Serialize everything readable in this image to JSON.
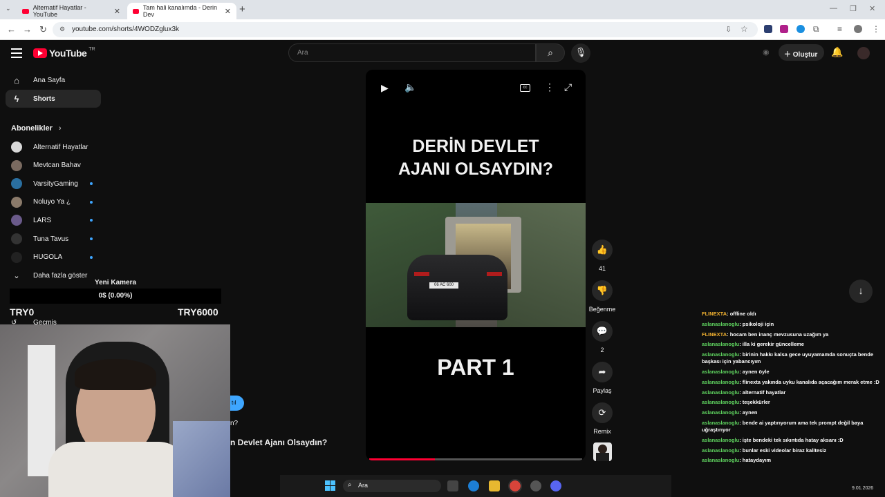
{
  "browser": {
    "tabs": [
      {
        "title": "Alternatif Hayatlar - YouTube"
      },
      {
        "title": "Tam hali kanalımda - Derin Dev"
      }
    ],
    "url": "youtube.com/shorts/4WODZglux3k"
  },
  "header": {
    "logo": "YouTube",
    "country": "TR",
    "search_placeholder": "Ara",
    "create_label": "Oluştur"
  },
  "sidebar": {
    "items": [
      {
        "label": "Ana Sayfa",
        "icon": "home-icon"
      },
      {
        "label": "Shorts",
        "icon": "shorts-icon"
      }
    ],
    "subs_heading": "Abonelikler",
    "subscriptions": [
      {
        "name": "Alternatif Hayatlar",
        "color": "#d8d8d8",
        "live": false
      },
      {
        "name": "Mevtcan Bahav",
        "color": "#7a6a60",
        "live": false
      },
      {
        "name": "VarsityGaming",
        "color": "#2a6fa0",
        "live": true
      },
      {
        "name": "Noluyo Ya ¿",
        "color": "#8a7a6a",
        "live": true
      },
      {
        "name": "LARS",
        "color": "#6a5a8a",
        "live": true
      },
      {
        "name": "Tuna Tavus",
        "color": "#333333",
        "live": true
      },
      {
        "name": "HUGOLA",
        "color": "#222222",
        "live": true
      }
    ],
    "more_label": "Daha fazla göster",
    "history_label": "Geçmiş"
  },
  "overlay": {
    "camera_title": "Yeni Kamera",
    "camera_progress": "0$ (0.00%)",
    "try_left": "TRY0",
    "try_right": "TRY6000"
  },
  "short": {
    "title_line1": "DERİN DEVLET",
    "title_line2": "AJANI OLSAYDIN?",
    "part_label": "PART 1",
    "plate": "06 AC 600",
    "progress": 0.31,
    "likes": "41",
    "dislike_label": "Beğenme",
    "comments": "2",
    "share_label": "Paylaş",
    "remix_label": "Remix"
  },
  "background": {
    "button_fragment": "tıl",
    "q_fragment": "n?",
    "title_fragment": "n Devlet Ajanı Olsaydın?"
  },
  "chat": [
    {
      "user": "FLINEXTA",
      "color": "#f0b030",
      "text": ": offline oldı"
    },
    {
      "user": "aslanaslanoglu",
      "color": "#5fd35f",
      "text": ": psikoloji için"
    },
    {
      "user": "FLINEXTA",
      "color": "#f0b030",
      "text": ": hocam ben inanç mevzusuna uzağım ya"
    },
    {
      "user": "aslanaslanoglu",
      "color": "#5fd35f",
      "text": ": illa ki gerekir güncelleme"
    },
    {
      "user": "aslanaslanoglu",
      "color": "#5fd35f",
      "text": ": birinin hakkı kalsa gece uyuyamamda sonuçta bende başkası için yabancıyım"
    },
    {
      "user": "aslanaslanoglu",
      "color": "#5fd35f",
      "text": ": aynen öyle"
    },
    {
      "user": "aslanaslanoglu",
      "color": "#5fd35f",
      "text": ": flinexta yakında uyku kanalıda açacağım merak etme :D"
    },
    {
      "user": "aslanaslanoglu",
      "color": "#5fd35f",
      "text": ": alternatif hayatlar"
    },
    {
      "user": "aslanaslanoglu",
      "color": "#5fd35f",
      "text": ": teşekkürler"
    },
    {
      "user": "aslanaslanoglu",
      "color": "#5fd35f",
      "text": ": aynen"
    },
    {
      "user": "aslanaslanoglu",
      "color": "#5fd35f",
      "text": ": bende ai yaptırıyorum ama tek prompt değil baya uğraştırıyor"
    },
    {
      "user": "aslanaslanoglu",
      "color": "#5fd35f",
      "text": ": işte bendeki tek sıkıntıda hatay aksanı :D"
    },
    {
      "user": "aslanaslanoglu",
      "color": "#5fd35f",
      "text": ": bunlar eski videolar biraz kalitesiz"
    },
    {
      "user": "aslanaslanoglu",
      "color": "#5fd35f",
      "text": ": hataydayım"
    }
  ],
  "taskbar": {
    "search_label": "Ara",
    "date": "9.01.2026"
  }
}
